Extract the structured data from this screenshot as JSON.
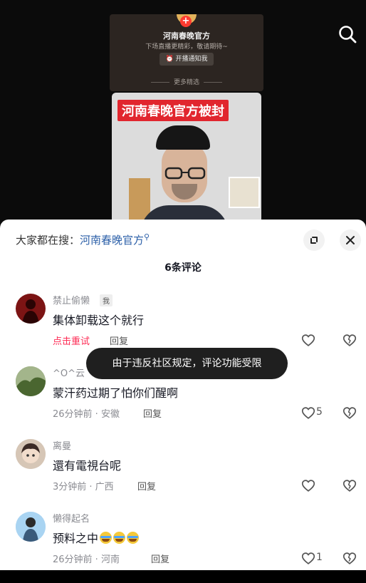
{
  "live_card": {
    "name": "河南春晚官方",
    "subtitle": "下场直播更精彩，敬请期待~",
    "notify_button": "开播通知我",
    "more_label": "更多精选"
  },
  "video": {
    "banner": "河南春晚官方被封"
  },
  "sheet": {
    "hot_search_prefix": "大家都在搜：",
    "hot_search_keyword": "河南春晚官方",
    "title": "6条评论"
  },
  "toast": "由于违反社区规定，评论功能受限",
  "comments": [
    {
      "user": "禁止偷懒",
      "badge": "我",
      "text": "集体卸载这个就行",
      "meta": "点击重试",
      "reply": "回复",
      "likes": ""
    },
    {
      "user": "^O^云",
      "text": "蒙汗药过期了怕你们醒啊",
      "meta": "26分钟前 · 安徽",
      "reply": "回复",
      "likes": "5"
    },
    {
      "user": "离曼",
      "text": "還有電視台呢",
      "meta": "3分钟前 · 广西",
      "reply": "回复",
      "likes": ""
    },
    {
      "user": "懒得起名",
      "text": "预料之中",
      "meta": "26分钟前 · 河南",
      "reply": "回复",
      "likes": "1"
    }
  ],
  "colors": {
    "accent_link": "#2b5fa8",
    "retry_red": "#fe2c55",
    "toast_bg": "#1f1f1f"
  }
}
